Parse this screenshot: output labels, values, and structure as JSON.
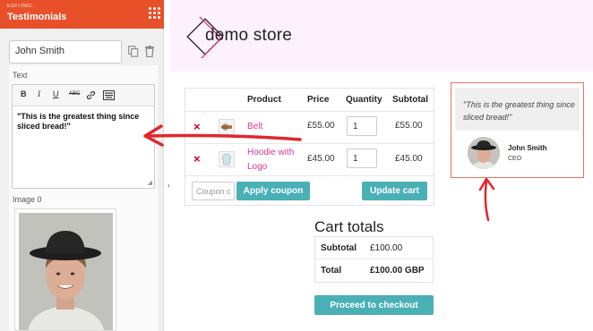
{
  "editor_panel": {
    "editing_label": "EDITING:",
    "title": "Testimonials",
    "name_value": "John Smith",
    "text_label": "Text",
    "toolbar": [
      "B",
      "I",
      "U",
      "ABC"
    ],
    "text_content": "\"This is the greatest thing since sliced bread!\"",
    "image_label": "Image 0"
  },
  "store": {
    "logo_text": "demo store",
    "brand_color": "#d63a8a",
    "accent_color": "#4ab0b6"
  },
  "cart": {
    "columns": [
      "Product",
      "Price",
      "Quantity",
      "Subtotal"
    ],
    "rows": [
      {
        "remove": "×",
        "product": "Belt",
        "price": "£55.00",
        "qty": "1",
        "subtotal": "£55.00"
      },
      {
        "remove": "×",
        "product_line1": "Hoodie with",
        "product_line2": "Logo",
        "price": "£45.00",
        "qty": "1",
        "subtotal": "£45.00"
      }
    ],
    "coupon_placeholder": "Coupon c",
    "apply_coupon_label": "Apply coupon",
    "update_cart_label": "Update cart"
  },
  "cart_totals": {
    "title": "Cart totals",
    "subtotal_label": "Subtotal",
    "subtotal_value": "£100.00",
    "total_label": "Total",
    "total_value": "£100.00 GBP",
    "checkout_label": "Proceed to checkout"
  },
  "testimonial": {
    "quote": "\"This is the greatest thing since sliced bread!\"",
    "name": "John Smith",
    "role": "CEO",
    "highlight_color": "#e57364"
  }
}
